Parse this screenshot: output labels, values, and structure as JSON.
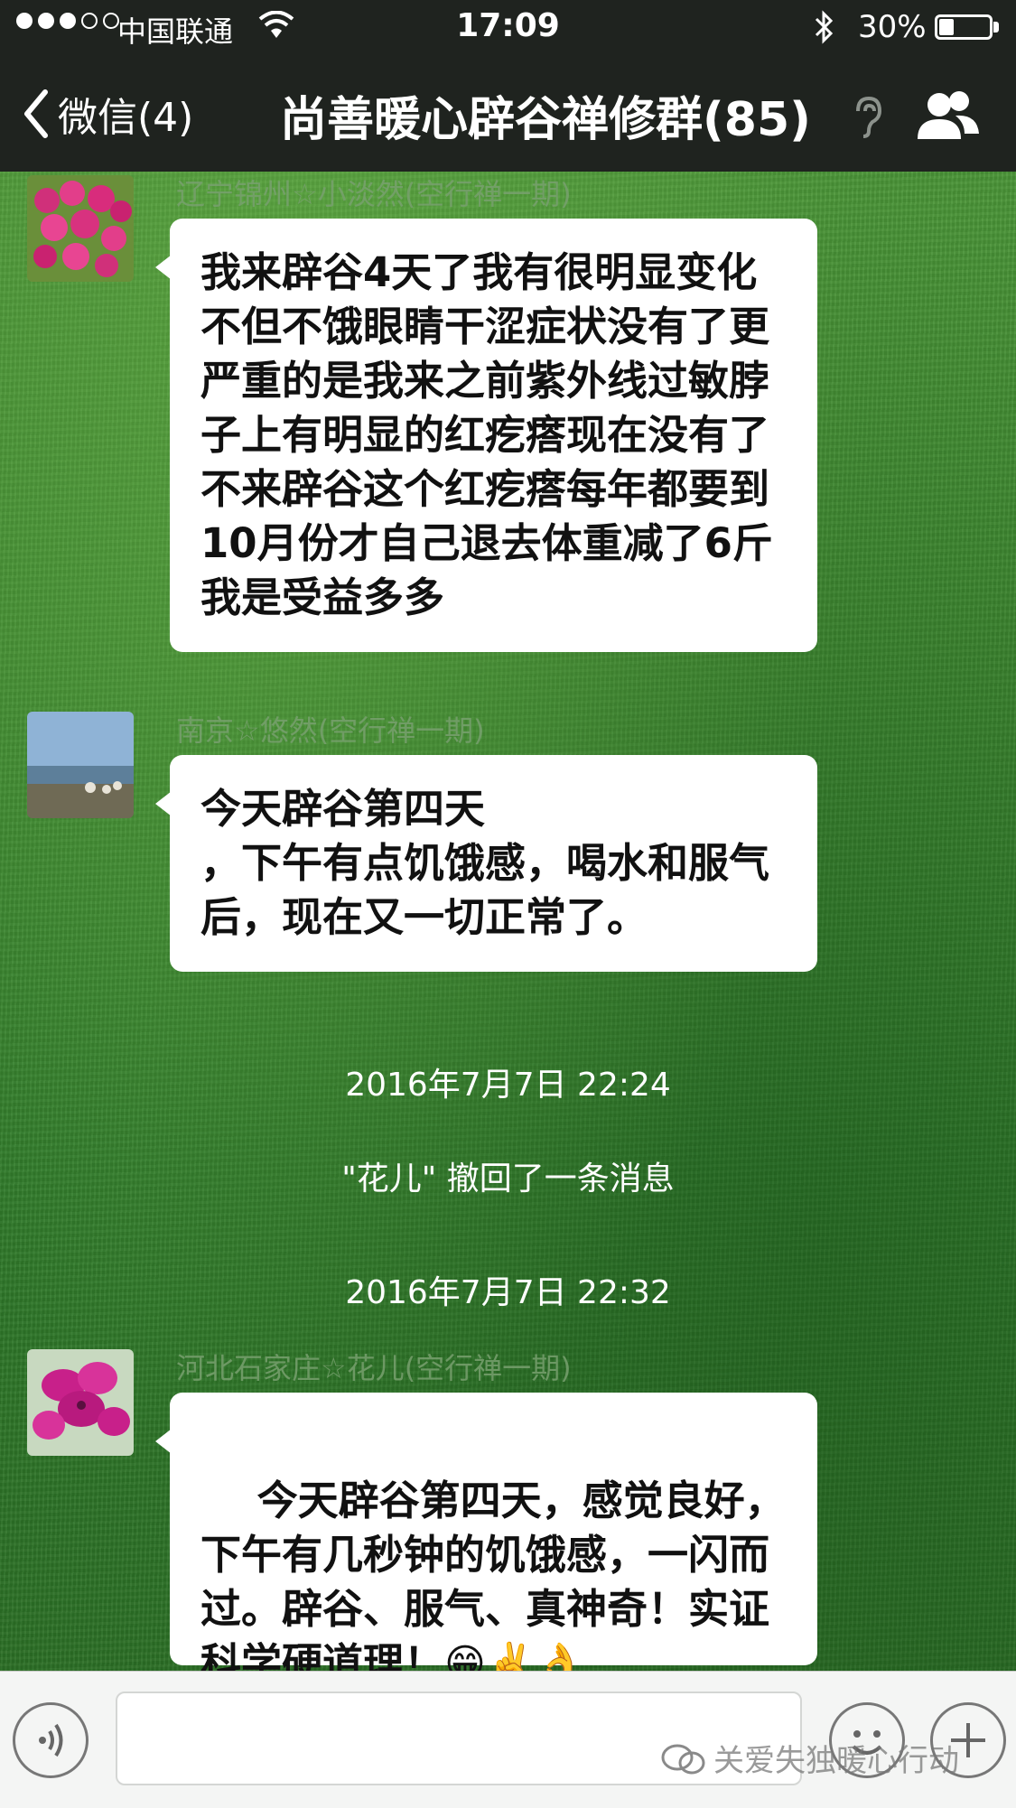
{
  "status_bar": {
    "carrier": "中国联通",
    "time": "17:09",
    "battery_percent": "30%",
    "battery_level": 0.3,
    "signal_bars_filled": 3,
    "signal_bars_total": 5
  },
  "nav": {
    "back_label": "微信(4)",
    "title": "尚善暖心辟谷禅修群(85)"
  },
  "messages": [
    {
      "sender": "辽宁锦州☆小淡然(空行禅一期)",
      "text": "我来辟谷4天了我有很明显变化不但不饿眼睛干涩症状没有了更严重的是我来之前紫外线过敏脖子上有明显的红疙瘩现在没有了不来辟谷这个红疙瘩每年都要到10月份才自己退去体重减了6斤我是受益多多"
    },
    {
      "sender": "南京☆悠然(空行禅一期)",
      "text": "今天辟谷第四天\n，下午有点饥饿感，喝水和服气后，现在又一切正常了。"
    },
    {
      "sender": "河北石家庄☆花儿(空行禅一期)",
      "text": "今天辟谷第四天，感觉良好，下午有几秒钟的饥饿感，一闪而过。辟谷、服气、真神奇！实证科学硬道理！",
      "emojis": [
        "😁",
        "✌️",
        "👌"
      ]
    }
  ],
  "system": {
    "time1": "2016年7月7日 22:24",
    "recall": "\"花儿\" 撤回了一条消息",
    "time2": "2016年7月7日 22:32"
  },
  "watermark": "关爱失独暖心行动",
  "colors": {
    "nav_bg": "#1f231f",
    "bubble_bg": "#ffffff",
    "grass": "#3f8a31"
  }
}
